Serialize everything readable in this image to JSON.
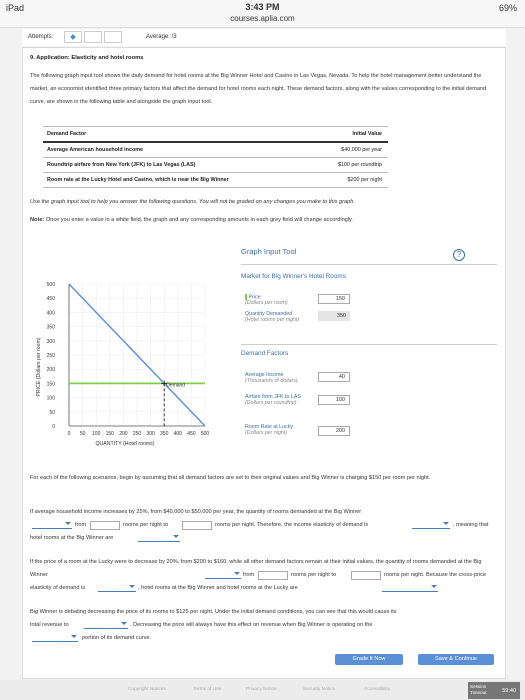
{
  "status": {
    "device": "iPad",
    "time": "3:43 PM",
    "url": "courses.aplia.com",
    "battery": "69%"
  },
  "attempts": {
    "label": "Attempts:",
    "average_label": "Average: /3"
  },
  "question": {
    "title": "9. Application: Elasticity and hotel rooms",
    "intro": "The following graph input tool shows the daily demand for hotel rooms at the Big Winner Hotel and Casino in Las Vegas, Nevada. To help the hotel management better understand the market, an economist identified three primary factors that affect the demand for hotel rooms each night. These demand factors, along with the values corresponding to the initial demand curve, are shown in the following table and alongside the graph input tool.",
    "table": {
      "headers": [
        "Demand Factor",
        "Initial Value"
      ],
      "rows": [
        [
          "Average American household income",
          "$40,000 per year"
        ],
        [
          "Roundtrip airfare from New York (JFK) to Las Vegas (LAS)",
          "$100 per roundtrip"
        ],
        [
          "Room rate at the Lucky Hotel and Casino, which is near the Big Winner",
          "$200 per night"
        ]
      ]
    },
    "instruction": "Use the graph input tool to help you answer the following questions. You will not be graded on any changes you make to this graph.",
    "note_label": "Note:",
    "note": "Once you enter a value in a white field, the graph and any corresponding amounts in each grey field will change accordingly."
  },
  "graph_tool": {
    "title": "Graph Input Tool",
    "market_title": "Market for Big Winner's Hotel Rooms",
    "price_label": "Price",
    "price_sub": "(Dollars per room)",
    "price_value": "150",
    "qty_label": "Quantity Demanded",
    "qty_sub": "(Hotel rooms per night)",
    "qty_value": "350",
    "demand_factors_title": "Demand Factors",
    "income_label": "Average Income",
    "income_sub": "(Thousands of dollars)",
    "income_value": "40",
    "airfare_label": "Airfare from JFK to LAS",
    "airfare_sub": "(Dollars per roundtrip)",
    "airfare_value": "100",
    "room_label": "Room Rate at Lucky",
    "room_sub": "(Dollars per night)",
    "room_value": "200"
  },
  "chart_data": {
    "type": "line",
    "xlabel": "QUANTITY (Hotel rooms)",
    "ylabel": "PRICE (Dollars per room)",
    "xlim": [
      0,
      500
    ],
    "ylim": [
      0,
      500
    ],
    "x_ticks": [
      0,
      50,
      100,
      150,
      200,
      250,
      300,
      350,
      400,
      450,
      500
    ],
    "y_ticks": [
      0,
      50,
      100,
      150,
      200,
      250,
      300,
      350,
      400,
      450,
      500
    ],
    "series": [
      {
        "name": "Demand",
        "x": [
          0,
          500
        ],
        "y": [
          500,
          0
        ]
      },
      {
        "name": "",
        "x": [
          0,
          500
        ],
        "y": [
          150,
          150
        ]
      }
    ],
    "point": {
      "x": 350,
      "y": 150
    },
    "colors": {
      "demand": "#5b8fd6",
      "price": "#7fcf4a"
    }
  },
  "questions": {
    "scenario_intro": "For each of the following scenarios, begin by assuming that all demand factors are set to their original values and Big Winner is charging $150 per room per night.",
    "q1_a": "If average household income increases by 25%, from $40,000 to $50,000 per year, the quantity of rooms demanded at the Big Winner",
    "q1_from": "from",
    "q1_rooms_to": "rooms per night to",
    "q1_rooms2": "rooms per night. Therefore, the income elasticity of demand is",
    "q1_meaning": ", meaning that",
    "q1_end": "hotel rooms at the Big Winner are",
    "q2_a": "If the price of a room at the Lucky were to decrease by 20%, from $200 to $160, while all other demand factors remain at their initial values, the quantity of rooms demanded at the Big Winner",
    "q2_from": "from",
    "q2_rooms_to": "rooms per night to",
    "q2_rooms2": "rooms per night. Because the cross-price",
    "q2_elastic": "elasticity of demand is",
    "q2_end": ", hotel rooms at the Big Winner and hotel rooms at the Lucky are",
    "q3_a": "Big Winner is debating decreasing the price of its rooms to $125 per night. Under the initial demand conditions, you can see that this would cause its",
    "q3_total": "total revenue to",
    "q3_b": ". Decreasing the price will always have this effect on revenue when Big Winner is operating on the",
    "q3_end": "portion of its demand curve."
  },
  "buttons": {
    "grade": "Grade It Now",
    "save": "Save & Continue"
  },
  "footer": {
    "links": [
      "Copyright Notices",
      "Terms of Use",
      "Privacy Notice",
      "Security Notice",
      "Accessibility"
    ],
    "session_label": "Session Timeout",
    "session_time": "59:40"
  },
  "colors": {
    "accent": "#3a6fa8",
    "grade_btn": "#5b8fd6",
    "save_btn": "#5b8fd6"
  }
}
